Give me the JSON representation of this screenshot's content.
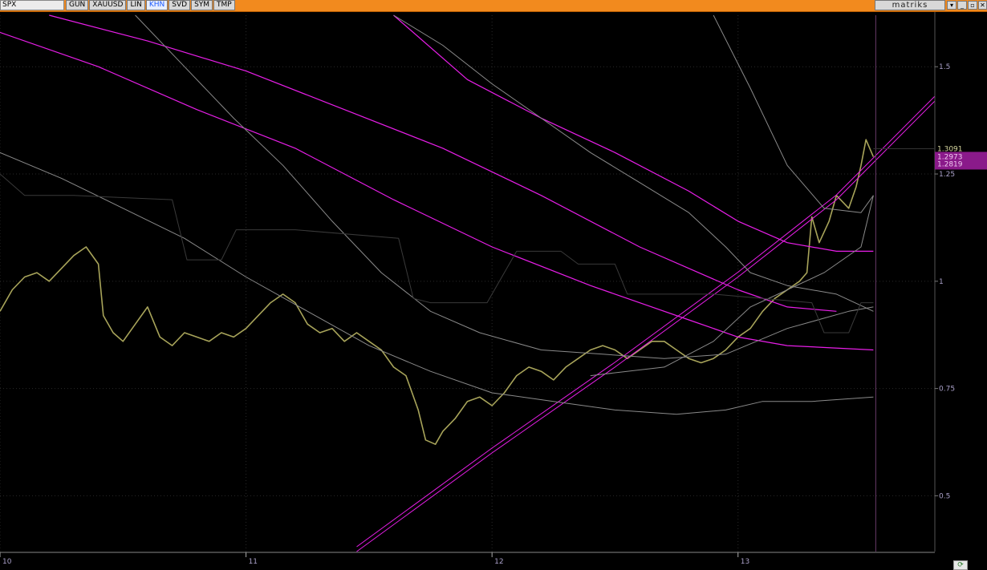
{
  "toolbar": {
    "symbol": "SPX",
    "tabs": [
      "GUN",
      "XAUUSD",
      "LIN",
      "KHN",
      "SVD",
      "SYM",
      "TMP"
    ],
    "active_tab": "KHN",
    "brand": "matriks",
    "window_buttons": [
      "▾",
      "_",
      "▫",
      "✕"
    ]
  },
  "colors": {
    "price": "#a8a45a",
    "magenta": "#e81ee8",
    "gray_line": "#8a8a8a",
    "dark_step": "#3a3a3a",
    "axis_text": "#a9a0c8",
    "badge_bg": "#8a1a8a"
  },
  "chart_data": {
    "type": "line",
    "y_axis": {
      "ticks": [
        0.5,
        0.75,
        1,
        1.25,
        1.5
      ],
      "ylim": [
        0.37,
        1.62
      ]
    },
    "x_axis": {
      "ticks": [
        "10",
        "11",
        "12",
        "13"
      ],
      "xlim": [
        10,
        13.8
      ]
    },
    "last_value": "1.3091",
    "badges": [
      "1.2973",
      "1.2819"
    ],
    "series": [
      {
        "id": "price",
        "values": [
          [
            10.0,
            0.93
          ],
          [
            10.05,
            0.98
          ],
          [
            10.1,
            1.01
          ],
          [
            10.15,
            1.02
          ],
          [
            10.2,
            1.0
          ],
          [
            10.25,
            1.03
          ],
          [
            10.3,
            1.06
          ],
          [
            10.35,
            1.08
          ],
          [
            10.4,
            1.04
          ],
          [
            10.42,
            0.92
          ],
          [
            10.46,
            0.88
          ],
          [
            10.5,
            0.86
          ],
          [
            10.55,
            0.9
          ],
          [
            10.6,
            0.94
          ],
          [
            10.65,
            0.87
          ],
          [
            10.7,
            0.85
          ],
          [
            10.75,
            0.88
          ],
          [
            10.8,
            0.87
          ],
          [
            10.85,
            0.86
          ],
          [
            10.9,
            0.88
          ],
          [
            10.95,
            0.87
          ],
          [
            11.0,
            0.89
          ],
          [
            11.05,
            0.92
          ],
          [
            11.1,
            0.95
          ],
          [
            11.15,
            0.97
          ],
          [
            11.2,
            0.95
          ],
          [
            11.25,
            0.9
          ],
          [
            11.3,
            0.88
          ],
          [
            11.35,
            0.89
          ],
          [
            11.4,
            0.86
          ],
          [
            11.45,
            0.88
          ],
          [
            11.5,
            0.86
          ],
          [
            11.55,
            0.84
          ],
          [
            11.6,
            0.8
          ],
          [
            11.65,
            0.78
          ],
          [
            11.7,
            0.7
          ],
          [
            11.73,
            0.63
          ],
          [
            11.77,
            0.62
          ],
          [
            11.8,
            0.65
          ],
          [
            11.85,
            0.68
          ],
          [
            11.9,
            0.72
          ],
          [
            11.95,
            0.73
          ],
          [
            12.0,
            0.71
          ],
          [
            12.05,
            0.74
          ],
          [
            12.1,
            0.78
          ],
          [
            12.15,
            0.8
          ],
          [
            12.2,
            0.79
          ],
          [
            12.25,
            0.77
          ],
          [
            12.3,
            0.8
          ],
          [
            12.35,
            0.82
          ],
          [
            12.4,
            0.84
          ],
          [
            12.45,
            0.85
          ],
          [
            12.5,
            0.84
          ],
          [
            12.55,
            0.82
          ],
          [
            12.6,
            0.84
          ],
          [
            12.65,
            0.86
          ],
          [
            12.7,
            0.86
          ],
          [
            12.75,
            0.84
          ],
          [
            12.8,
            0.82
          ],
          [
            12.85,
            0.81
          ],
          [
            12.9,
            0.82
          ],
          [
            12.95,
            0.84
          ],
          [
            13.0,
            0.87
          ],
          [
            13.05,
            0.89
          ],
          [
            13.1,
            0.93
          ],
          [
            13.15,
            0.96
          ],
          [
            13.2,
            0.98
          ],
          [
            13.25,
            1.0
          ],
          [
            13.28,
            1.02
          ],
          [
            13.3,
            1.15
          ],
          [
            13.33,
            1.09
          ],
          [
            13.37,
            1.14
          ],
          [
            13.4,
            1.2
          ],
          [
            13.45,
            1.17
          ],
          [
            13.48,
            1.22
          ],
          [
            13.5,
            1.27
          ],
          [
            13.52,
            1.33
          ],
          [
            13.55,
            1.29
          ]
        ]
      },
      {
        "id": "magenta-ma-long",
        "values": [
          [
            10.2,
            1.62
          ],
          [
            10.6,
            1.56
          ],
          [
            11.0,
            1.49
          ],
          [
            11.4,
            1.4
          ],
          [
            11.8,
            1.31
          ],
          [
            12.2,
            1.2
          ],
          [
            12.6,
            1.08
          ],
          [
            13.0,
            0.98
          ],
          [
            13.2,
            0.94
          ],
          [
            13.4,
            0.93
          ]
        ]
      },
      {
        "id": "magenta-ma-mid",
        "values": [
          [
            10.0,
            1.58
          ],
          [
            10.4,
            1.5
          ],
          [
            10.8,
            1.4
          ],
          [
            11.2,
            1.31
          ],
          [
            11.6,
            1.19
          ],
          [
            12.0,
            1.08
          ],
          [
            12.4,
            0.99
          ],
          [
            12.8,
            0.91
          ],
          [
            13.0,
            0.87
          ],
          [
            13.2,
            0.85
          ],
          [
            13.55,
            0.84
          ]
        ]
      },
      {
        "id": "magenta-ma-curve",
        "values": [
          [
            11.6,
            1.62
          ],
          [
            11.9,
            1.47
          ],
          [
            12.2,
            1.38
          ],
          [
            12.5,
            1.3
          ],
          [
            12.8,
            1.21
          ],
          [
            13.0,
            1.14
          ],
          [
            13.2,
            1.09
          ],
          [
            13.4,
            1.07
          ],
          [
            13.55,
            1.07
          ]
        ]
      },
      {
        "id": "trendline",
        "values": [
          [
            11.45,
            0.37
          ],
          [
            12.0,
            0.6
          ],
          [
            12.5,
            0.8
          ],
          [
            13.0,
            1.01
          ],
          [
            13.4,
            1.19
          ],
          [
            13.8,
            1.42
          ]
        ]
      },
      {
        "id": "gray-envelope-upper",
        "values": [
          [
            12.9,
            1.62
          ],
          [
            13.05,
            1.45
          ],
          [
            13.2,
            1.27
          ],
          [
            13.35,
            1.17
          ],
          [
            13.5,
            1.16
          ],
          [
            13.55,
            1.2
          ]
        ]
      },
      {
        "id": "gray-envelope-lower",
        "values": [
          [
            12.4,
            0.78
          ],
          [
            12.7,
            0.8
          ],
          [
            12.9,
            0.86
          ],
          [
            13.05,
            0.94
          ],
          [
            13.2,
            0.98
          ],
          [
            13.35,
            1.02
          ],
          [
            13.5,
            1.08
          ],
          [
            13.55,
            1.2
          ]
        ]
      },
      {
        "id": "gray-ma-1",
        "values": [
          [
            10.55,
            1.62
          ],
          [
            10.75,
            1.5
          ],
          [
            10.95,
            1.38
          ],
          [
            11.15,
            1.27
          ],
          [
            11.35,
            1.14
          ],
          [
            11.55,
            1.02
          ],
          [
            11.75,
            0.93
          ],
          [
            11.95,
            0.88
          ],
          [
            12.2,
            0.84
          ],
          [
            12.45,
            0.83
          ],
          [
            12.7,
            0.82
          ],
          [
            12.95,
            0.83
          ],
          [
            13.2,
            0.89
          ],
          [
            13.45,
            0.93
          ],
          [
            13.55,
            0.94
          ]
        ]
      },
      {
        "id": "gray-ma-2",
        "values": [
          [
            10.0,
            1.3
          ],
          [
            10.25,
            1.24
          ],
          [
            10.5,
            1.17
          ],
          [
            10.75,
            1.1
          ],
          [
            11.0,
            1.01
          ],
          [
            11.25,
            0.93
          ],
          [
            11.5,
            0.85
          ],
          [
            11.75,
            0.79
          ],
          [
            12.0,
            0.74
          ],
          [
            12.25,
            0.72
          ],
          [
            12.5,
            0.7
          ],
          [
            12.75,
            0.69
          ],
          [
            12.95,
            0.7
          ],
          [
            13.1,
            0.72
          ],
          [
            13.3,
            0.72
          ],
          [
            13.55,
            0.73
          ]
        ]
      },
      {
        "id": "gray-ma-3",
        "values": [
          [
            11.6,
            1.62
          ],
          [
            11.8,
            1.55
          ],
          [
            12.0,
            1.46
          ],
          [
            12.2,
            1.38
          ],
          [
            12.4,
            1.3
          ],
          [
            12.6,
            1.23
          ],
          [
            12.8,
            1.16
          ],
          [
            12.95,
            1.08
          ],
          [
            13.05,
            1.02
          ],
          [
            13.2,
            0.99
          ],
          [
            13.4,
            0.97
          ],
          [
            13.55,
            0.93
          ]
        ]
      },
      {
        "id": "dark-step",
        "values": [
          [
            10.0,
            1.25
          ],
          [
            10.1,
            1.2
          ],
          [
            10.3,
            1.2
          ],
          [
            10.7,
            1.19
          ],
          [
            10.76,
            1.05
          ],
          [
            10.9,
            1.05
          ],
          [
            10.96,
            1.12
          ],
          [
            11.2,
            1.12
          ],
          [
            11.62,
            1.1
          ],
          [
            11.68,
            0.96
          ],
          [
            11.75,
            0.95
          ],
          [
            11.98,
            0.95
          ],
          [
            12.1,
            1.07
          ],
          [
            12.28,
            1.07
          ],
          [
            12.35,
            1.04
          ],
          [
            12.5,
            1.04
          ],
          [
            12.55,
            0.97
          ],
          [
            12.9,
            0.97
          ],
          [
            13.3,
            0.95
          ],
          [
            13.35,
            0.88
          ],
          [
            13.45,
            0.88
          ],
          [
            13.5,
            0.95
          ],
          [
            13.55,
            0.95
          ]
        ]
      }
    ]
  }
}
